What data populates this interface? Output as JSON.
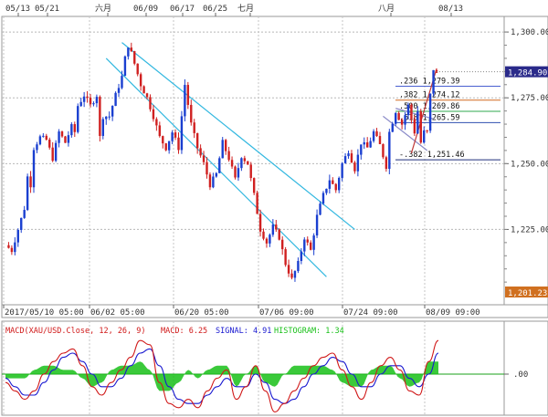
{
  "chart_data": [
    {
      "type": "candlestick",
      "symbol": "XAU/USD",
      "top_date_labels": [
        "05/13",
        "05/21",
        "六月",
        "06/09",
        "06/17",
        "06/25",
        "七月",
        "八月",
        "08/13"
      ],
      "bottom_time_labels": [
        "2017/05/10 05:00",
        "06/02 05:00",
        "06/20 05:00",
        "07/06 09:00",
        "07/24 09:00",
        "08/09 09:00"
      ],
      "y_ticks": [
        "1,300.00",
        "1,275.00",
        "1,250.00",
        "1,225.00"
      ],
      "ylim": [
        1201.23,
        1303.5
      ],
      "last_price_label": "1,284.90",
      "low_price_label": "1,201.23",
      "grid": true,
      "fib_levels": [
        {
          "label": ".236 1,279.39",
          "value": 1279.39,
          "color": "#4a5fd0"
        },
        {
          "label": ".382 1,274.12",
          "value": 1274.12,
          "color": "#d2691e"
        },
        {
          "label": ".500 1,269.86",
          "value": 1269.86,
          "color": "#2fa84f"
        },
        {
          "label": ".618 1,265.59",
          "value": 1265.59,
          "color": "#2f4fb0"
        },
        {
          "label": "-.382 1,251.46",
          "value": 1251.46,
          "color": "#1f2f7a"
        }
      ],
      "price_path": [
        [
          0,
          1219
        ],
        [
          2,
          1217
        ],
        [
          4,
          1225
        ],
        [
          6,
          1233
        ],
        [
          7,
          1245
        ],
        [
          8,
          1242
        ],
        [
          9,
          1256
        ],
        [
          11,
          1260
        ],
        [
          13,
          1259
        ],
        [
          15,
          1252
        ],
        [
          17,
          1262
        ],
        [
          19,
          1258
        ],
        [
          21,
          1264
        ],
        [
          22,
          1262
        ],
        [
          23,
          1272
        ],
        [
          25,
          1276
        ],
        [
          27,
          1272
        ],
        [
          29,
          1276
        ],
        [
          30,
          1260
        ],
        [
          31,
          1268
        ],
        [
          33,
          1268
        ],
        [
          35,
          1276
        ],
        [
          37,
          1283
        ],
        [
          38,
          1290
        ],
        [
          39,
          1295
        ],
        [
          40,
          1292
        ],
        [
          41,
          1288
        ],
        [
          43,
          1280
        ],
        [
          45,
          1275
        ],
        [
          47,
          1268
        ],
        [
          49,
          1260
        ],
        [
          51,
          1256
        ],
        [
          53,
          1262
        ],
        [
          55,
          1256
        ],
        [
          57,
          1280
        ],
        [
          59,
          1265
        ],
        [
          61,
          1256
        ],
        [
          63,
          1250
        ],
        [
          65,
          1242
        ],
        [
          67,
          1246
        ],
        [
          69,
          1258
        ],
        [
          71,
          1252
        ],
        [
          73,
          1244
        ],
        [
          75,
          1253
        ],
        [
          77,
          1250
        ],
        [
          79,
          1238
        ],
        [
          81,
          1225
        ],
        [
          83,
          1220
        ],
        [
          85,
          1226
        ],
        [
          87,
          1222
        ],
        [
          89,
          1212
        ],
        [
          91,
          1206
        ],
        [
          93,
          1212
        ],
        [
          95,
          1222
        ],
        [
          97,
          1217
        ],
        [
          99,
          1230
        ],
        [
          101,
          1238
        ],
        [
          103,
          1244
        ],
        [
          105,
          1240
        ],
        [
          107,
          1250
        ],
        [
          109,
          1255
        ],
        [
          111,
          1248
        ],
        [
          113,
          1258
        ],
        [
          115,
          1256
        ],
        [
          117,
          1262
        ],
        [
          119,
          1257
        ],
        [
          121,
          1249
        ],
        [
          122,
          1262
        ],
        [
          124,
          1270
        ],
        [
          126,
          1265
        ],
        [
          128,
          1272
        ],
        [
          130,
          1262
        ],
        [
          131,
          1270
        ],
        [
          132,
          1258
        ],
        [
          133,
          1262
        ],
        [
          134,
          1262
        ],
        [
          135,
          1276
        ],
        [
          136,
          1286
        ],
        [
          137,
          1284
        ]
      ],
      "channel_lines": [
        {
          "points": [
            [
              37,
              1296
            ],
            [
              111,
              1225
            ]
          ],
          "color": "#33b8e0"
        },
        {
          "points": [
            [
              32,
              1290
            ],
            [
              102,
              1207
            ]
          ],
          "color": "#33b8e0"
        },
        {
          "points": [
            [
              120,
              1268
            ],
            [
              134,
              1255
            ]
          ],
          "color": "#8a8ac8"
        },
        {
          "points": [
            [
              124,
              1271
            ],
            [
              136,
              1267
            ]
          ],
          "color": "#8a8ac8"
        },
        {
          "points": [
            [
              129,
              1254
            ],
            [
              137,
              1286
            ]
          ],
          "color": "#c03838"
        }
      ]
    },
    {
      "type": "line",
      "title": "MACD(XAU/USD.Close, 12, 26, 9)",
      "legend": [
        {
          "label": "MACD: 6.25",
          "color": "#d01818"
        },
        {
          "label": "SIGNAL: 4.91",
          "color": "#1818d0"
        },
        {
          "label": "HISTOGRAM: 1.34",
          "color": "#18c018"
        }
      ],
      "y_ticks": [
        ".00"
      ],
      "ylim": [
        -10,
        10
      ],
      "series": [
        {
          "name": "MACD",
          "color": "#d01818",
          "values": [
            -2,
            -4,
            -6,
            -4,
            0,
            3,
            5,
            6,
            2,
            -3,
            -5,
            -2,
            1,
            4,
            8,
            7,
            -2,
            -7,
            -8,
            -6,
            -8,
            -4,
            -1,
            1,
            -6,
            -3,
            2,
            -4,
            -9,
            -7,
            -4,
            -1,
            2,
            4,
            5,
            1,
            -3,
            -6,
            -2,
            2,
            4,
            1,
            -4,
            -5,
            3,
            8
          ]
        },
        {
          "name": "SIGNAL",
          "color": "#1818d0",
          "values": [
            -1,
            -3,
            -5,
            -5,
            -2,
            1,
            4,
            5,
            3,
            0,
            -3,
            -3,
            -1,
            2,
            5,
            6,
            2,
            -3,
            -6,
            -7,
            -7,
            -5,
            -3,
            -1,
            -3,
            -3,
            0,
            -2,
            -6,
            -7,
            -6,
            -3,
            0,
            2,
            4,
            3,
            0,
            -3,
            -3,
            0,
            2,
            2,
            -1,
            -3,
            0,
            5
          ]
        },
        {
          "name": "HISTOGRAM",
          "color": "#18c018",
          "values": [
            -1,
            -1,
            -1,
            1,
            2,
            2,
            1,
            1,
            -1,
            -3,
            -2,
            1,
            2,
            2,
            3,
            1,
            -4,
            -4,
            -2,
            1,
            -1,
            1,
            2,
            2,
            -3,
            0,
            2,
            -2,
            -3,
            0,
            2,
            2,
            2,
            2,
            1,
            -2,
            -3,
            -3,
            1,
            2,
            2,
            -1,
            -3,
            -2,
            3,
            3
          ]
        }
      ]
    }
  ]
}
